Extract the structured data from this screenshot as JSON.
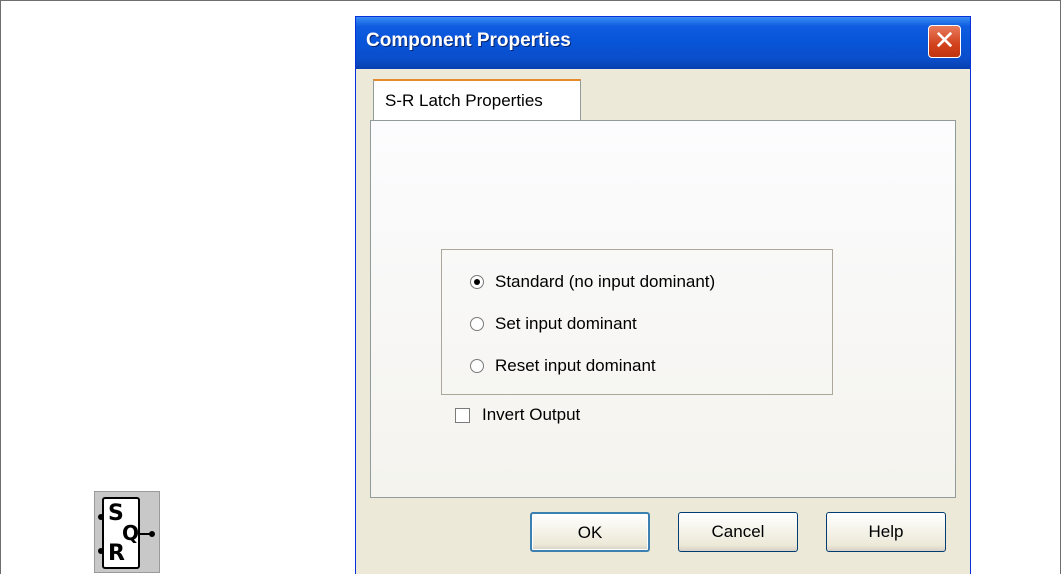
{
  "dialog": {
    "title": "Component Properties",
    "close_icon": "close-icon"
  },
  "tabs": [
    {
      "label": "S-R Latch Properties",
      "selected": true
    }
  ],
  "latch_mode": {
    "options": [
      {
        "label": "Standard (no input dominant)",
        "checked": true
      },
      {
        "label": "Set input dominant",
        "checked": false
      },
      {
        "label": "Reset input dominant",
        "checked": false
      }
    ]
  },
  "invert_output": {
    "label": "Invert Output",
    "checked": false
  },
  "buttons": {
    "ok": "OK",
    "cancel": "Cancel",
    "help": "Help"
  },
  "latch_symbol": {
    "set_label": "S",
    "reset_label": "R",
    "output_label": "Q"
  },
  "colors": {
    "titlebar": "#0854d8",
    "dialog_bg": "#ece9d8",
    "close": "#d2421c"
  }
}
